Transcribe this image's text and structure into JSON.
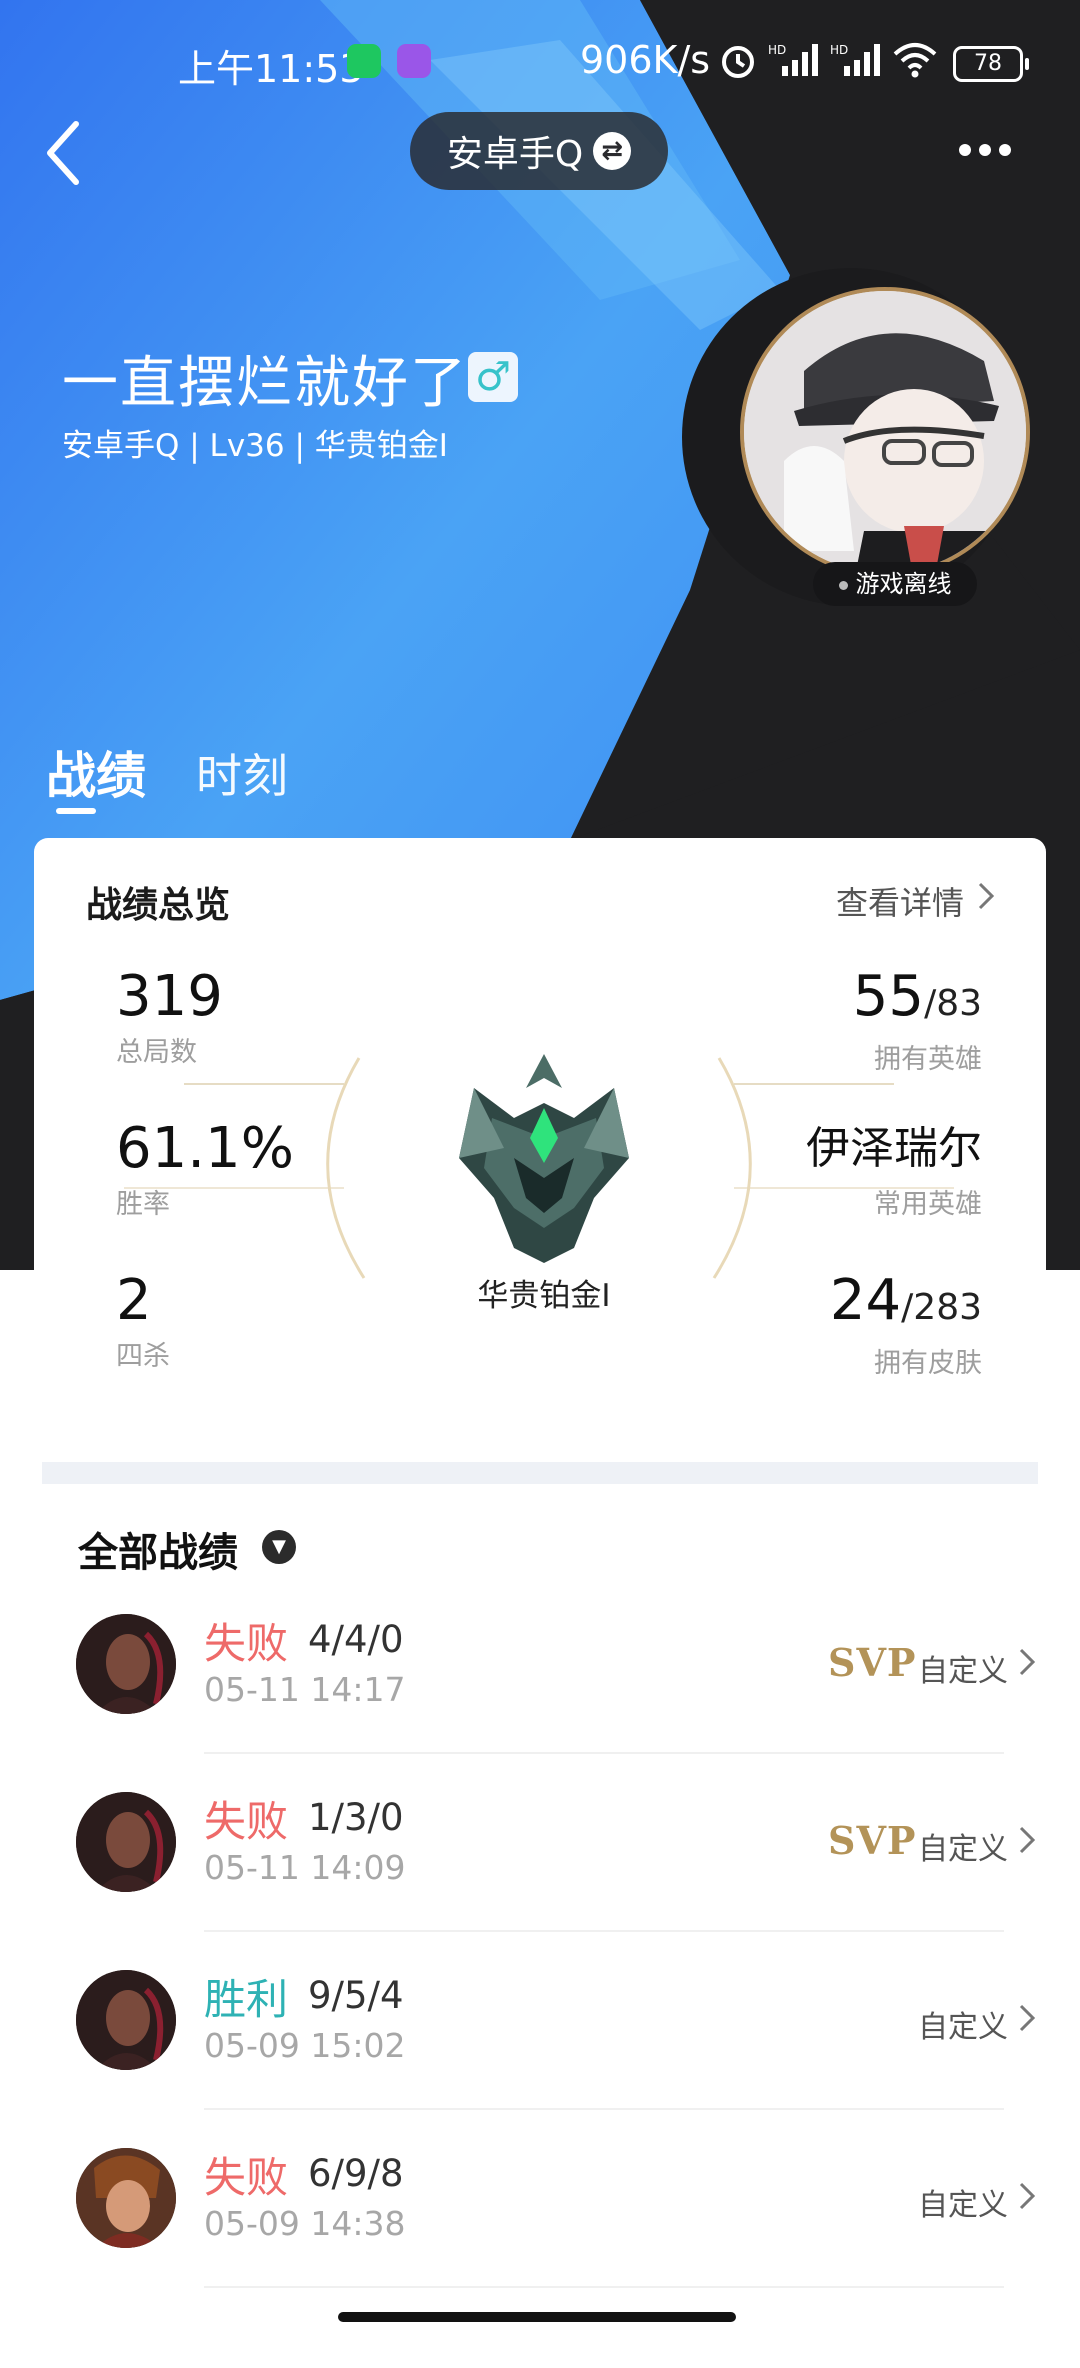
{
  "status_bar": {
    "time": "上午11:53",
    "speed": "906K/s",
    "battery": "78",
    "icons": [
      "wechat-icon",
      "app-notification-icon",
      "alarm-icon",
      "hd-signal-icon",
      "hd-signal-icon",
      "wifi-icon",
      "battery-icon"
    ]
  },
  "nav": {
    "back_icon": "chevron-left-icon",
    "account_label": "安卓手Q",
    "swap_icon": "swap-icon",
    "more_icon": "more-dots-icon"
  },
  "profile": {
    "name": "一直摆烂就好了",
    "gender_icon": "male-icon",
    "gender_glyph": "♂",
    "meta": "安卓手Q | Lv36 | 华贵铂金I",
    "status": "游戏离线"
  },
  "tabs": [
    {
      "label": "战绩",
      "active": true
    },
    {
      "label": "时刻",
      "active": false
    }
  ],
  "overview": {
    "title": "战绩总览",
    "detail_link": "查看详情",
    "stats_left": [
      {
        "value": "319",
        "label": "总局数"
      },
      {
        "value": "61.1%",
        "label": "胜率"
      },
      {
        "value": "2",
        "label": "四杀"
      }
    ],
    "stats_right": [
      {
        "value": "55",
        "total": "/83",
        "label": "拥有英雄"
      },
      {
        "value": "伊泽瑞尔",
        "total": "",
        "label": "常用英雄"
      },
      {
        "value": "24",
        "total": "/283",
        "label": "拥有皮肤"
      }
    ],
    "rank_name": "华贵铂金I"
  },
  "matches_section": {
    "title": "全部战绩",
    "dropdown_icon": "chevron-down-icon",
    "matches": [
      {
        "result": "失败",
        "outcome": "lose",
        "kda": "4/4/0",
        "time": "05-11 14:17",
        "svp": "SVP",
        "mode": "自定义"
      },
      {
        "result": "失败",
        "outcome": "lose",
        "kda": "1/3/0",
        "time": "05-11 14:09",
        "svp": "SVP",
        "mode": "自定义"
      },
      {
        "result": "胜利",
        "outcome": "win",
        "kda": "9/5/4",
        "time": "05-09 15:02",
        "svp": "",
        "mode": "自定义"
      },
      {
        "result": "失败",
        "outcome": "lose",
        "kda": "6/9/8",
        "time": "05-09 14:38",
        "svp": "",
        "mode": "自定义"
      }
    ]
  },
  "colors": {
    "hero_blue": "#3b82f0",
    "hero_dark": "#1f1f21",
    "lose": "#ee6a69",
    "win": "#2eb2b4",
    "svp_gold": "#b39358",
    "divider": "#eef1f6"
  }
}
